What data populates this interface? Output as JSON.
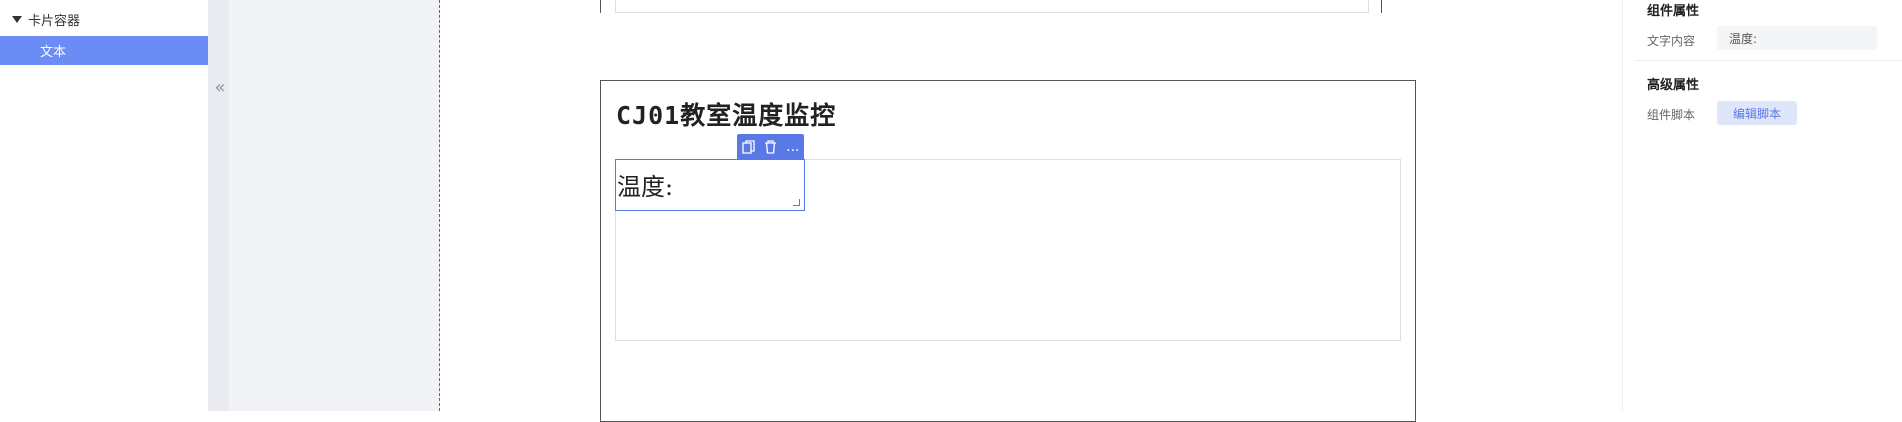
{
  "tree": {
    "parent_label": "卡片容器",
    "child_label": "文本"
  },
  "icons": {
    "collapse": "double-chevron-left-icon",
    "copy": "copy-icon",
    "delete": "trash-icon",
    "more": "more-icon"
  },
  "canvas": {
    "card_title": "CJ01教室温度监控",
    "text_component_value": "温度:",
    "toolbar": {
      "more_label": "..."
    }
  },
  "properties": {
    "component_section_title": "组件属性",
    "text_content_label": "文字内容",
    "text_content_value": "温度:",
    "advanced_section_title": "高级属性",
    "script_label": "组件脚本",
    "edit_script_button": "编辑脚本"
  },
  "colors": {
    "accent": "#5a78e6",
    "selected_tree_bg": "#6b8cf5"
  }
}
